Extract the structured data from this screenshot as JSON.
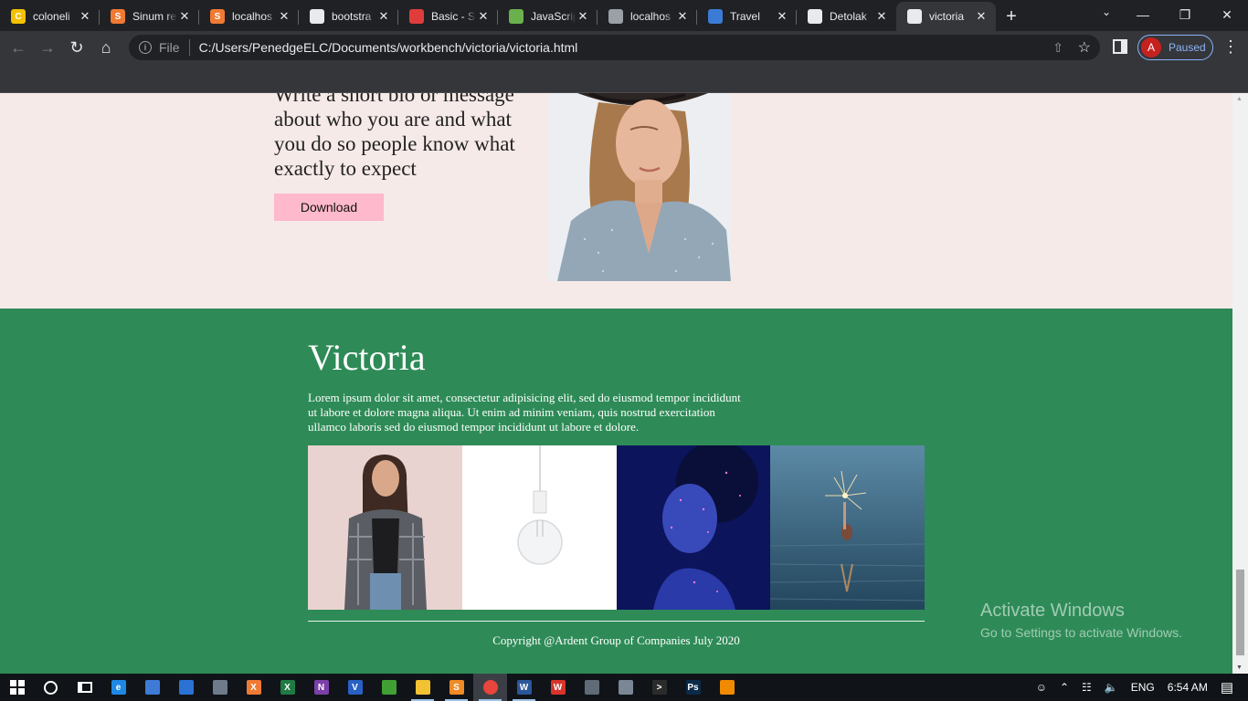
{
  "browser": {
    "tabs": [
      {
        "title": "coloneli",
        "favicon_color": "#f2c200",
        "favicon_glyph": "C"
      },
      {
        "title": "Sinum re",
        "favicon_color": "#f07a34",
        "favicon_glyph": "S"
      },
      {
        "title": "localhos",
        "favicon_color": "#f07a34",
        "favicon_glyph": "S"
      },
      {
        "title": "bootstra",
        "favicon_color": "#e8eaed",
        "favicon_glyph": ""
      },
      {
        "title": "Basic - S",
        "favicon_color": "#e03c3c",
        "favicon_glyph": ""
      },
      {
        "title": "JavaScrip",
        "favicon_color": "#6ab04c",
        "favicon_glyph": ""
      },
      {
        "title": "localhos",
        "favicon_color": "#9aa0a6",
        "favicon_glyph": ""
      },
      {
        "title": "Travel",
        "favicon_color": "#3a7bd5",
        "favicon_glyph": ""
      },
      {
        "title": "Detolak",
        "favicon_color": "#e8eaed",
        "favicon_glyph": ""
      },
      {
        "title": "victoria",
        "favicon_color": "#e8eaed",
        "favicon_glyph": ""
      }
    ],
    "active_tab_index": 9,
    "address": {
      "scheme_label": "File",
      "url": "C:/Users/PenedgeELC/Documents/workbench/victoria/victoria.html"
    },
    "profile": {
      "initial": "A",
      "status": "Paused"
    }
  },
  "page": {
    "hero": {
      "partial_line": "Write a short bio or message",
      "bio": "about who you are and what you do so people know what exactly to expect",
      "download_label": "Download"
    },
    "footer": {
      "brand": "Victoria",
      "about": "Lorem ipsum dolor sit amet, consectetur adipisicing elit, sed do eiusmod tempor incididunt ut labore et dolore magna aliqua. Ut enim ad minim veniam, quis nostrud exercitation ullamco laboris sed do eiusmod tempor incididunt ut labore et dolore.",
      "copyright": "Copyright @Ardent Group of Companies July 2020"
    }
  },
  "watermark": {
    "title": "Activate Windows",
    "subtitle": "Go to Settings to activate Windows."
  },
  "taskbar": {
    "apps": [
      {
        "name": "edge",
        "color": "#1e88e5",
        "glyph": "e"
      },
      {
        "name": "store",
        "color": "#3d7bd6",
        "glyph": ""
      },
      {
        "name": "defender",
        "color": "#2a72d4",
        "glyph": ""
      },
      {
        "name": "remote-desktop",
        "color": "#6d7b8a",
        "glyph": ""
      },
      {
        "name": "xampp",
        "color": "#f07a34",
        "glyph": "X"
      },
      {
        "name": "excel",
        "color": "#1f7a43",
        "glyph": "X"
      },
      {
        "name": "onenote",
        "color": "#7b3fa8",
        "glyph": "N"
      },
      {
        "name": "vs",
        "color": "#2860c4",
        "glyph": "V"
      },
      {
        "name": "xbox",
        "color": "#41a034",
        "glyph": ""
      },
      {
        "name": "file-explorer",
        "color": "#f1c232",
        "glyph": ""
      },
      {
        "name": "sublime",
        "color": "#f08a24",
        "glyph": "S"
      },
      {
        "name": "chrome",
        "color": "#e8453c",
        "glyph": ""
      },
      {
        "name": "word",
        "color": "#2b579a",
        "glyph": "W"
      },
      {
        "name": "wps",
        "color": "#d9342b",
        "glyph": "W"
      },
      {
        "name": "calculator",
        "color": "#5f6b76",
        "glyph": ""
      },
      {
        "name": "vpn",
        "color": "#7b8794",
        "glyph": ""
      },
      {
        "name": "cmd",
        "color": "#2b2b2b",
        "glyph": ">"
      },
      {
        "name": "photoshop",
        "color": "#0b2a4a",
        "glyph": "Ps"
      },
      {
        "name": "vlc",
        "color": "#f08a00",
        "glyph": ""
      }
    ],
    "language": "ENG",
    "time": "6:54 AM"
  }
}
